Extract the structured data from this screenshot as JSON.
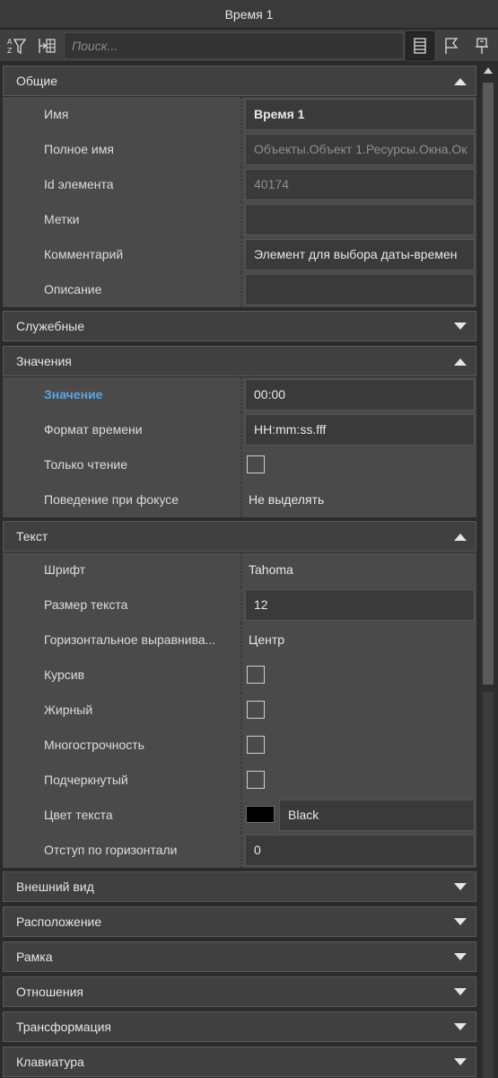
{
  "window": {
    "title": "Время 1"
  },
  "toolbar": {
    "search_placeholder": "Поиск...",
    "buttons": [
      "sort-az-filter-icon",
      "columns-icon",
      "list-view-icon",
      "flag-icon",
      "pin-icon"
    ]
  },
  "sections": {
    "general": {
      "label": "Общие",
      "expanded": true,
      "rows": [
        {
          "name": "Имя",
          "value": "Время 1"
        },
        {
          "name": "Полное имя",
          "value": "Объекты.Объект 1.Ресурсы.Окна.Ок"
        },
        {
          "name": "Id элемента",
          "value": "40174"
        },
        {
          "name": "Метки",
          "value": ""
        },
        {
          "name": "Комментарий",
          "value": "Элемент для выбора даты-времен"
        },
        {
          "name": "Описание",
          "value": ""
        }
      ]
    },
    "service": {
      "label": "Служебные",
      "expanded": false
    },
    "values": {
      "label": "Значения",
      "expanded": true,
      "rows": [
        {
          "name": "Значение",
          "value": "00:00"
        },
        {
          "name": "Формат времени",
          "value": "HH:mm:ss.fff"
        },
        {
          "name": "Только чтение",
          "checked": false
        },
        {
          "name": "Поведение при фокусе",
          "value": "Не выделять"
        }
      ]
    },
    "text": {
      "label": "Текст",
      "expanded": true,
      "rows": [
        {
          "name": "Шрифт",
          "value": "Tahoma"
        },
        {
          "name": "Размер текста",
          "value": "12"
        },
        {
          "name": "Горизонтальное выравнива...",
          "value": "Центр"
        },
        {
          "name": "Курсив",
          "checked": false
        },
        {
          "name": "Жирный",
          "checked": false
        },
        {
          "name": "Многострочность",
          "checked": false
        },
        {
          "name": "Подчеркнутый",
          "checked": false
        },
        {
          "name": "Цвет текста",
          "value": "Black",
          "swatch": "#000000"
        },
        {
          "name": "Отступ по горизонтали",
          "value": "0"
        }
      ]
    },
    "appearance": {
      "label": "Внешний вид",
      "expanded": false
    },
    "layout": {
      "label": "Расположение",
      "expanded": false
    },
    "frame": {
      "label": "Рамка",
      "expanded": false
    },
    "relations": {
      "label": "Отношения",
      "expanded": false
    },
    "transform": {
      "label": "Трансформация",
      "expanded": false
    },
    "keyboard": {
      "label": "Клавиатура",
      "expanded": false
    }
  },
  "colors": {
    "accent": "#5fa3d9",
    "background": "#4a4a4a",
    "header": "#404040"
  }
}
